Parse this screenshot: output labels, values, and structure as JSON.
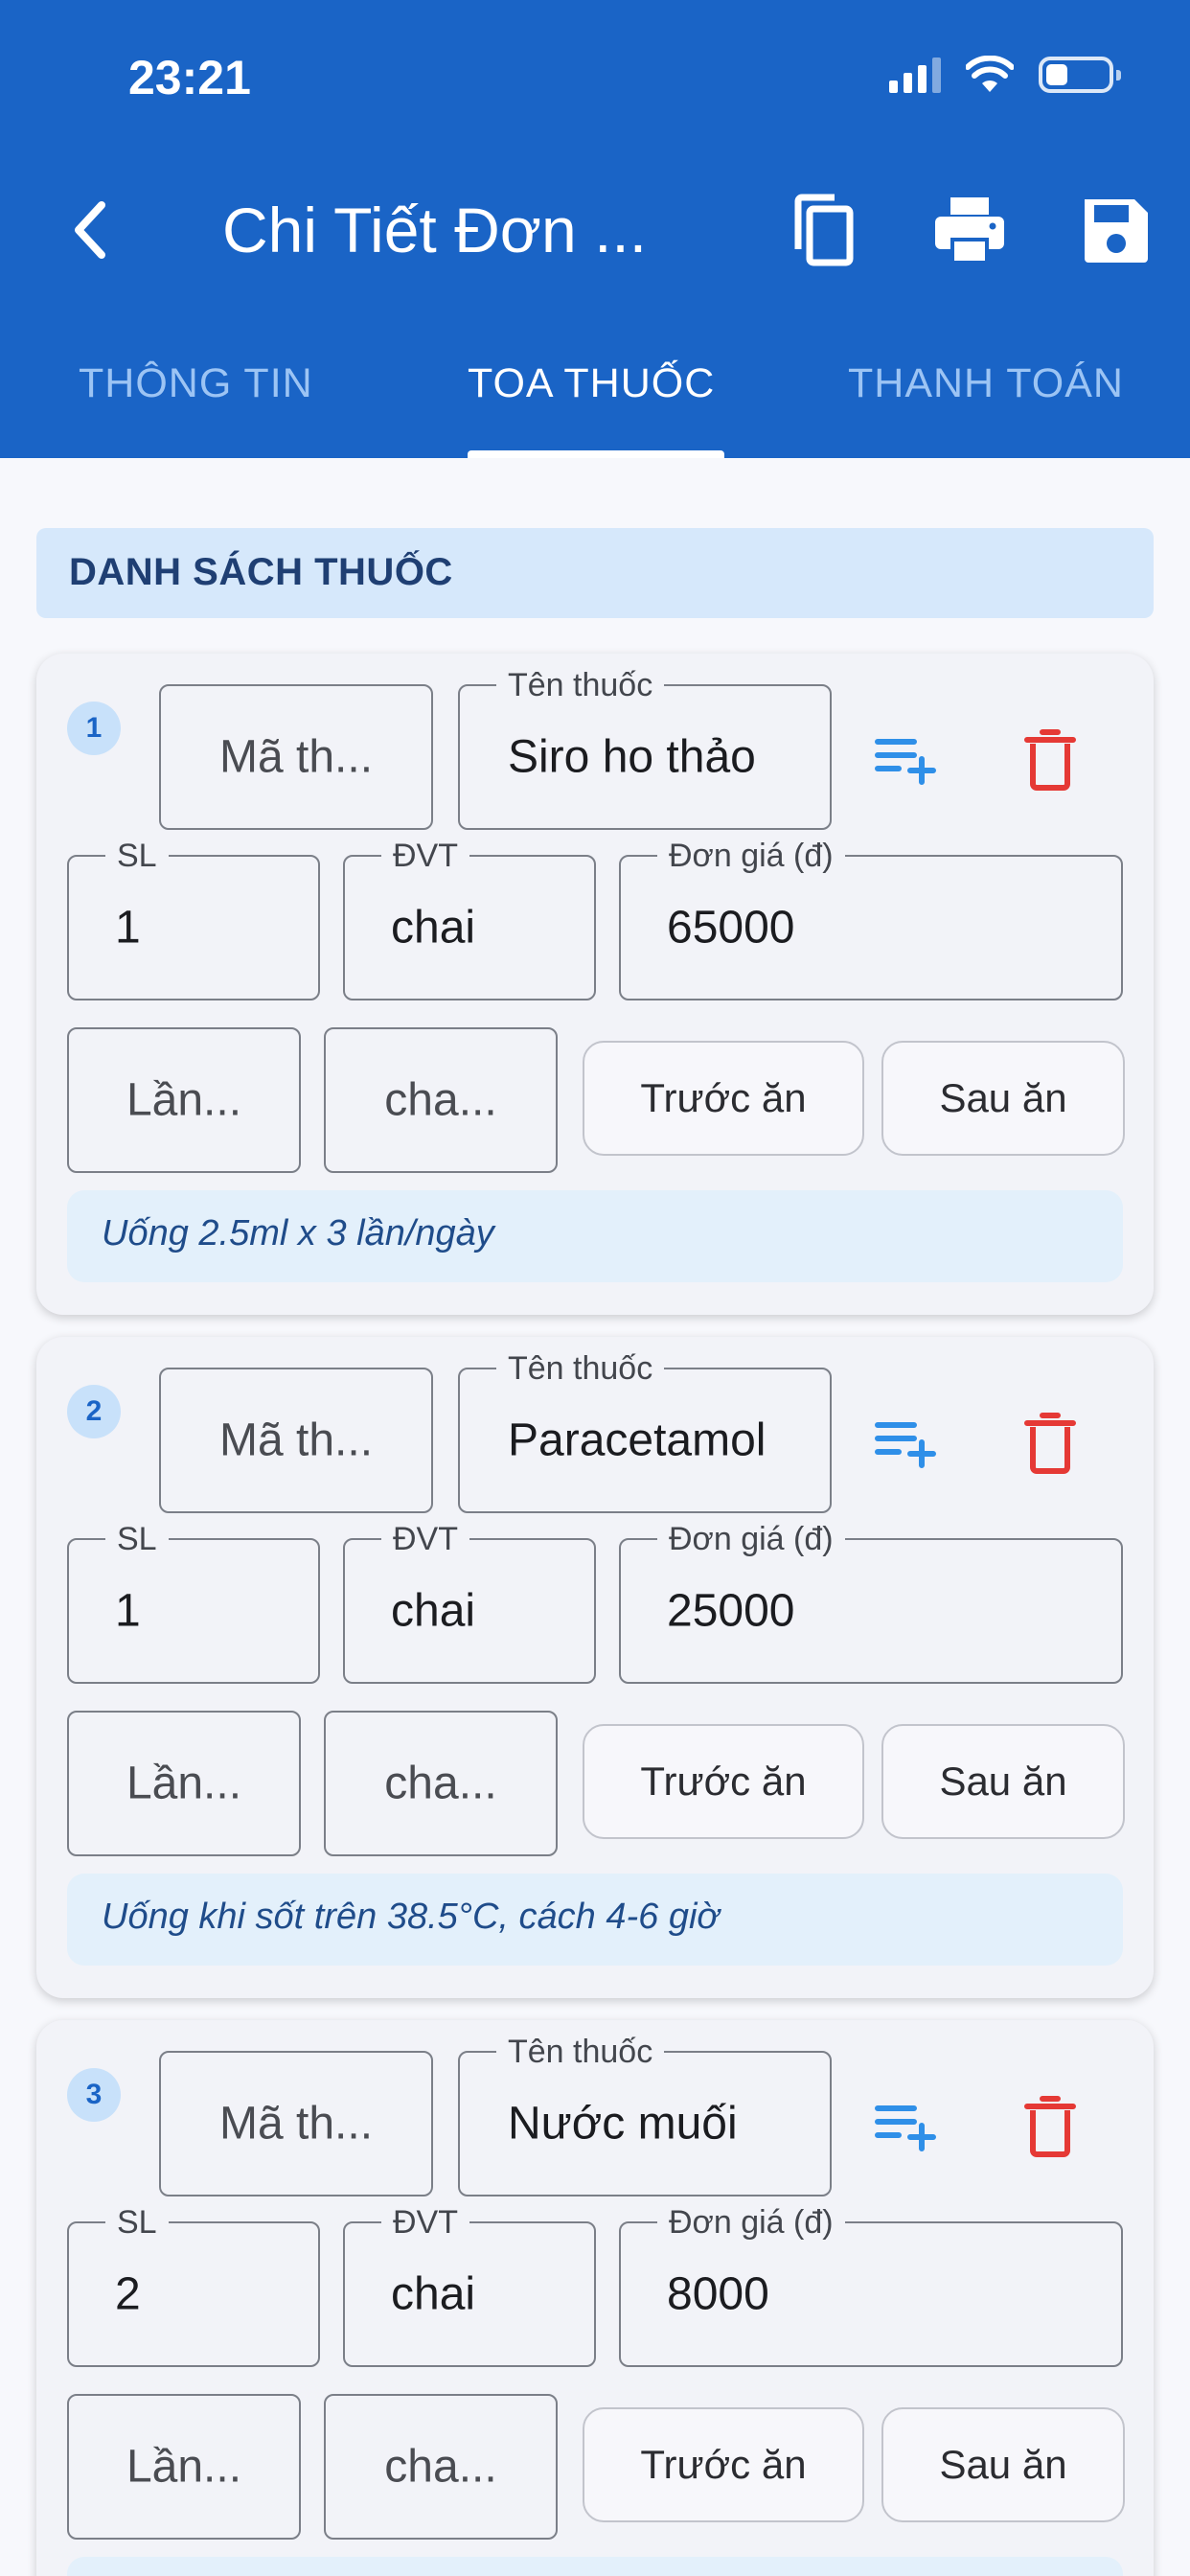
{
  "status_bar": {
    "time": "23:21"
  },
  "toolbar": {
    "title": "Chi Tiết Đơn ...",
    "icons": {
      "back": "arrow-back-icon",
      "copy": "copy-icon",
      "print": "print-icon",
      "save": "save-icon"
    }
  },
  "tabs": [
    {
      "label": "THÔNG TIN",
      "active": false
    },
    {
      "label": "TOA THUỐC",
      "active": true
    },
    {
      "label": "THANH TOÁN",
      "active": false
    }
  ],
  "section": {
    "title": "DANH SÁCH THUỐC"
  },
  "labels": {
    "name": "Tên thuốc",
    "sl": "SL",
    "dvt": "ĐVT",
    "price": "Đơn giá (đ)",
    "before_meal": "Trước ăn",
    "after_meal": "Sau ăn"
  },
  "medicines": [
    {
      "index": "1",
      "code_placeholder": "Mã th...",
      "name": "Siro ho thảo",
      "qty": "1",
      "unit": "chai",
      "price": "65000",
      "times_placeholder": "Lần...",
      "unit_placeholder": "cha...",
      "note": "Uống 2.5ml x 3 lần/ngày"
    },
    {
      "index": "2",
      "code_placeholder": "Mã th...",
      "name": "Paracetamol",
      "qty": "1",
      "unit": "chai",
      "price": "25000",
      "times_placeholder": "Lần...",
      "unit_placeholder": "cha...",
      "note": "Uống khi sốt trên 38.5°C, cách 4-6 giờ"
    },
    {
      "index": "3",
      "code_placeholder": "Mã th...",
      "name": "Nước muối",
      "qty": "2",
      "unit": "chai",
      "price": "8000",
      "times_placeholder": "Lần...",
      "unit_placeholder": "cha...",
      "note": ""
    }
  ],
  "colors": {
    "primary": "#1A64C6",
    "tab_inactive": "#9CC4F4",
    "section_bg": "#D6E8FB",
    "delete": "#E53935",
    "add_line": "#2F8FE8"
  }
}
